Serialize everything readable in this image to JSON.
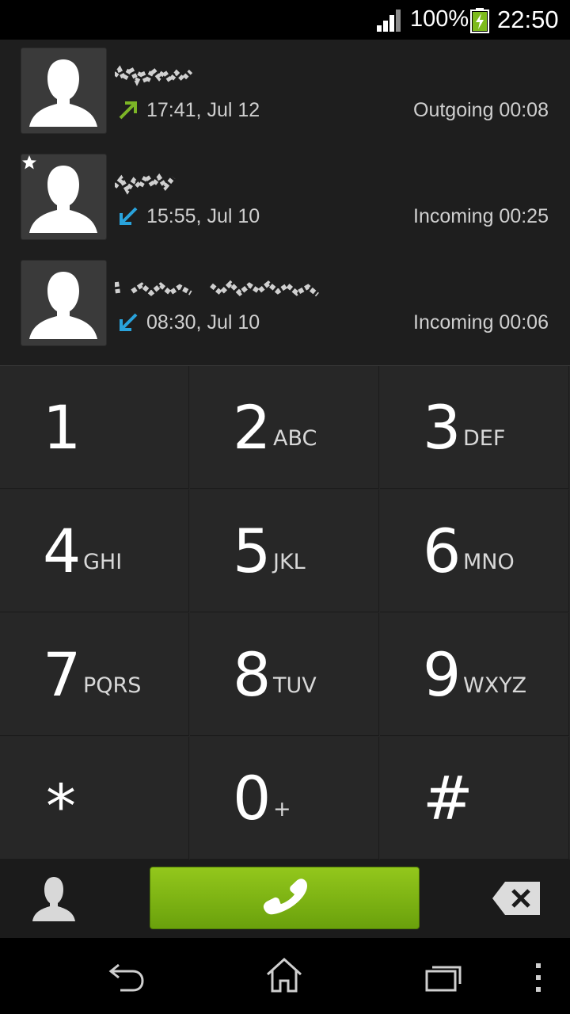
{
  "status_bar": {
    "battery_percent": "100%",
    "time": "22:50",
    "icons": [
      "signal-icon",
      "battery-charging-icon"
    ]
  },
  "call_log": [
    {
      "time": "17:41, Jul 12",
      "type": "Outgoing 00:08",
      "direction": "outgoing",
      "starred": false
    },
    {
      "time": "15:55, Jul 10",
      "type": "Incoming 00:25",
      "direction": "incoming",
      "starred": true
    },
    {
      "time": "08:30, Jul 10",
      "type": "Incoming 00:06",
      "direction": "incoming",
      "starred": false
    }
  ],
  "dialpad": {
    "keys": [
      {
        "digit": "1",
        "letters": ""
      },
      {
        "digit": "2",
        "letters": "ABC"
      },
      {
        "digit": "3",
        "letters": "DEF"
      },
      {
        "digit": "4",
        "letters": "GHI"
      },
      {
        "digit": "5",
        "letters": "JKL"
      },
      {
        "digit": "6",
        "letters": "MNO"
      },
      {
        "digit": "7",
        "letters": "PQRS"
      },
      {
        "digit": "8",
        "letters": "TUV"
      },
      {
        "digit": "9",
        "letters": "WXYZ"
      },
      {
        "digit": "*",
        "letters": ""
      },
      {
        "digit": "0",
        "letters": "+"
      },
      {
        "digit": "#",
        "letters": ""
      }
    ]
  },
  "colors": {
    "call_button": "#7fb515",
    "outgoing_arrow": "#7cb526",
    "incoming_arrow": "#29a3dc"
  },
  "icons": {
    "contacts": "contacts-icon",
    "call": "phone-handset-icon",
    "backspace": "backspace-icon",
    "nav": [
      "back-icon",
      "home-icon",
      "recent-apps-icon",
      "menu-icon"
    ]
  }
}
